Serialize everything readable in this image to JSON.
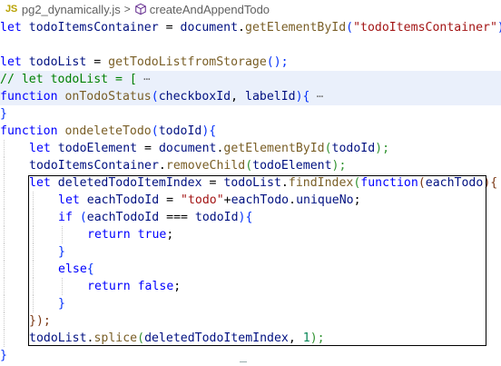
{
  "breadcrumb": {
    "file_badge": "JS",
    "file_name": "pg2_dynamically.js",
    "separator": ">",
    "symbol_icon": "cube-icon",
    "symbol_name": "createAndAppendTodo"
  },
  "code": {
    "l1": {
      "a": "let",
      "b": " todoItemsContainer",
      "c": " = ",
      "d": "document",
      "e": ".",
      "f": "getElementById",
      "g": "(",
      "h": "\"todoItemsContainer\"",
      "i": ");"
    },
    "l3": {
      "a": "let",
      "b": " todoList",
      "c": " = ",
      "d": "getTodoListfromStorage",
      "e": "();"
    },
    "l4": {
      "a": "// let todoList = [",
      "b": " ⋯"
    },
    "l5": {
      "a": "function",
      "b": " onTodoStatus",
      "c": "(",
      "d": "checkboxId",
      "e": ", ",
      "f": "labelId",
      "g": "){",
      "h": " ⋯"
    },
    "l6": {
      "a": "}"
    },
    "l7": {
      "a": "function",
      "b": " ondeleteTodo",
      "c": "(",
      "d": "todoId",
      "e": "){"
    },
    "l8": {
      "a": "let",
      "b": " todoElement",
      "c": " = ",
      "d": "document",
      "e": ".",
      "f": "getElementById",
      "g": "(",
      "h": "todoId",
      "i": ");"
    },
    "l9": {
      "a": "todoItemsContainer",
      "b": ".",
      "c": "removeChild",
      "d": "(",
      "e": "todoElement",
      "f": ");"
    },
    "l10": {
      "a": "let",
      "b": " deletedTodoItemIndex",
      "c": " = ",
      "d": "todoList",
      "e": ".",
      "f": "findIndex",
      "g": "(",
      "h": "function",
      "i": "(",
      "j": "eachTodo",
      "k": "){"
    },
    "l11": {
      "a": "let",
      "b": " eachTodoId",
      "c": " = ",
      "d": "\"todo\"",
      "e": "+",
      "f": "eachTodo",
      "g": ".",
      "h": "uniqueNo",
      "i": ";"
    },
    "l12": {
      "a": "if",
      "b": " (",
      "c": "eachTodoId",
      "d": " === ",
      "e": "todoId",
      "f": "){"
    },
    "l13": {
      "a": "return",
      "b": " true",
      "c": ";"
    },
    "l14": {
      "a": "}"
    },
    "l15": {
      "a": "else",
      "b": "{"
    },
    "l16": {
      "a": "return",
      "b": " false",
      "c": ";"
    },
    "l17": {
      "a": "}"
    },
    "l18": {
      "a": "});"
    },
    "l19": {
      "a": "todoList",
      "b": ".",
      "c": "splice",
      "d": "(",
      "e": "deletedTodoItemIndex",
      "f": ", ",
      "g": "1",
      "h": ");"
    },
    "l20": {
      "a": "}"
    }
  },
  "colors": {
    "keyword": "#0000ff",
    "identifier": "#001080",
    "function": "#795e26",
    "string": "#a31515",
    "number": "#098658",
    "comment": "#008000",
    "line_highlight": "#eaf0fb"
  }
}
